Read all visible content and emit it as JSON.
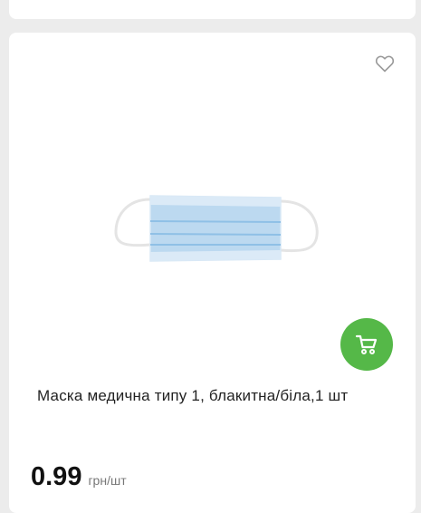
{
  "product": {
    "title": "Маска медична типу 1, блакитна/біла,1 шт",
    "price": "0.99",
    "unit": "грн/шт"
  },
  "icons": {
    "favorite": "heart-outline-icon",
    "cart": "shopping-cart-icon"
  },
  "colors": {
    "accent": "#55b848",
    "mask": "#bcd9f0"
  }
}
